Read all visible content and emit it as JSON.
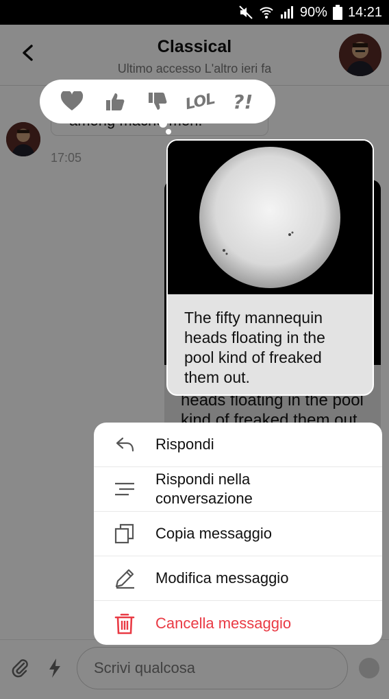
{
  "status": {
    "battery": "90%",
    "time": "14:21"
  },
  "header": {
    "title": "Classical",
    "subtitle": "Ultimo accesso L'altro ieri fa"
  },
  "messages": {
    "left_text": "among macho men.",
    "left_time": "17:05",
    "image_text": "The fifty mannequin heads floating in the pool kind of freaked them out."
  },
  "reactions": {
    "lol": "LOL",
    "exclaim": "?!"
  },
  "menu": {
    "reply": "Rispondi",
    "reply_thread": "Rispondi nella conversazione",
    "copy": "Copia messaggio",
    "edit": "Modifica messaggio",
    "delete": "Cancella messaggio"
  },
  "composer": {
    "placeholder": "Scrivi qualcosa"
  },
  "colors": {
    "danger": "#e93a44",
    "overlay": "#000000"
  }
}
